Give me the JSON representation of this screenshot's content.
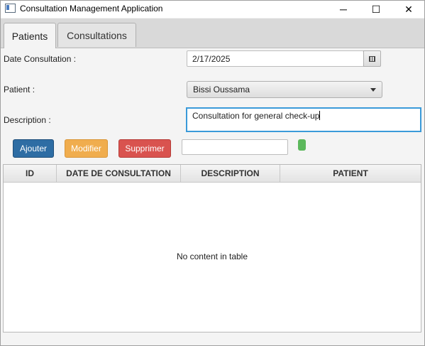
{
  "window": {
    "title": "Consultation Management Application",
    "minimize": "─",
    "maximize": "☐",
    "close": "✕"
  },
  "tabs": [
    {
      "label": "Patients",
      "active": true
    },
    {
      "label": "Consultations",
      "active": false
    }
  ],
  "form": {
    "date_label": "Date Consultation :",
    "date_value": "2/17/2025",
    "patient_label": "Patient :",
    "patient_value": "Bissi Oussama",
    "description_label": "Description :",
    "description_value": "Consultation for general check-up"
  },
  "actions": {
    "add_label": "Ajouter",
    "edit_label": "Modifier",
    "delete_label": "Supprimer",
    "search_value": ""
  },
  "colors": {
    "add": "#2e6da4",
    "edit": "#f0ad4e",
    "delete": "#d9534f",
    "status": "#5cb85c",
    "focus": "#3a9ad9"
  },
  "table": {
    "columns": [
      "ID",
      "DATE DE CONSULTATION",
      "DESCRIPTION",
      "PATIENT"
    ],
    "empty_message": "No content in table"
  }
}
